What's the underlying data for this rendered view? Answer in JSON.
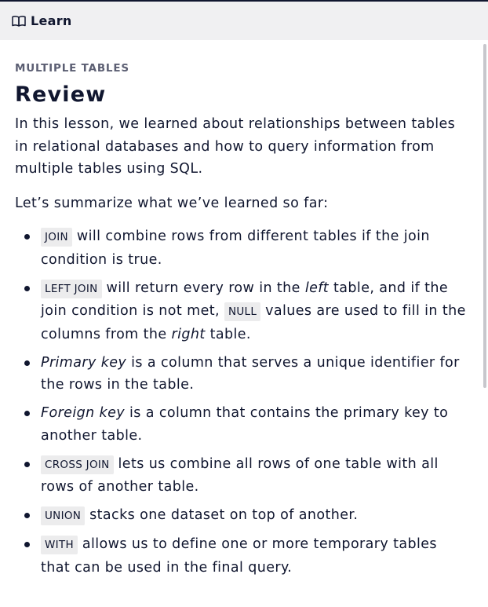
{
  "header": {
    "title": "Learn"
  },
  "lesson": {
    "eyebrow": "MULTIPLE TABLES",
    "title": "Review",
    "intro": "In this lesson, we learned about relationships between tables in relational databases and how to query information from multiple tables using SQL.",
    "summary_lead": "Let’s summarize what we’ve learned so far:",
    "points": [
      {
        "code": "JOIN",
        "text": " will combine rows from different tables if the join condition is true."
      },
      {
        "code": "LEFT JOIN",
        "t1": " will return every row in the ",
        "em1": "left",
        "t2": " table, and if the join condition is not met, ",
        "code2": "NULL",
        "t3": " values are used to fill in the columns from the ",
        "em2": "right",
        "t4": " table."
      },
      {
        "em": "Primary key",
        "text": " is a column that serves a unique identifier for the rows in the table."
      },
      {
        "em": "Foreign key",
        "text": " is a column that contains the primary key to another table."
      },
      {
        "code": "CROSS JOIN",
        "text": " lets us combine all rows of one table with all rows of another table."
      },
      {
        "code": "UNION",
        "text": " stacks one dataset on top of another."
      },
      {
        "code": "WITH",
        "text": " allows us to define one or more temporary tables that can be used in the final query."
      }
    ]
  }
}
